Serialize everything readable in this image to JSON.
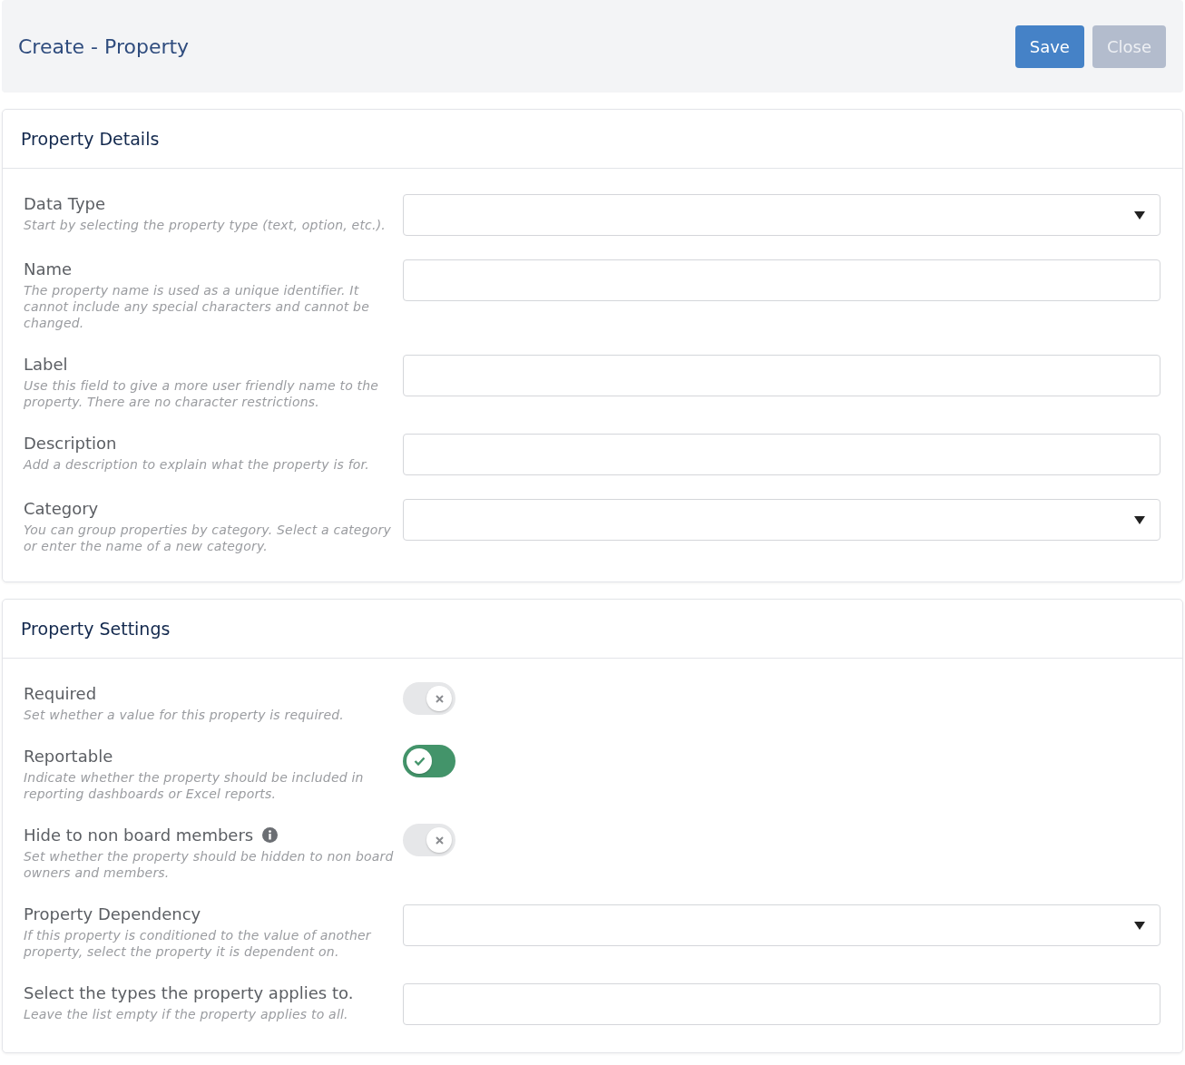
{
  "header": {
    "title": "Create - Property",
    "buttons": [
      {
        "label": "Save",
        "kind": "primary"
      },
      {
        "label": "Close",
        "kind": "secondary"
      }
    ]
  },
  "sections": [
    {
      "title": "Property Details",
      "fields": [
        {
          "kind": "select",
          "label": "Data Type",
          "help": "Start by selecting the property type (text, option, etc.)."
        },
        {
          "kind": "input",
          "label": "Name",
          "help": "The property name is used as a unique identifier. It cannot include any special characters and cannot be changed."
        },
        {
          "kind": "input",
          "label": "Label",
          "help": "Use this field to give a more user friendly name to the property. There are no character restrictions."
        },
        {
          "kind": "input",
          "label": "Description",
          "help": "Add a description to explain what the property is for."
        },
        {
          "kind": "select",
          "label": "Category",
          "help": "You can group properties by category. Select a category or enter the name of a new category."
        }
      ]
    },
    {
      "title": "Property Settings",
      "fields": [
        {
          "kind": "toggle",
          "label": "Required",
          "help": "Set whether a value for this property is required.",
          "on": false
        },
        {
          "kind": "toggle",
          "label": "Reportable",
          "help": "Indicate whether the property should be included in reporting dashboards or Excel reports.",
          "on": true
        },
        {
          "kind": "toggle",
          "label": "Hide to non board members",
          "help": "Set whether the property should be hidden to non board owners and members.",
          "on": false,
          "info": true
        },
        {
          "kind": "select",
          "label": "Property Dependency",
          "help": "If this property is conditioned to the value of another property, select the property it is dependent on."
        },
        {
          "kind": "input",
          "label": "Select the types the property applies to.",
          "help": "Leave the list empty if the property applies to all."
        }
      ]
    }
  ]
}
